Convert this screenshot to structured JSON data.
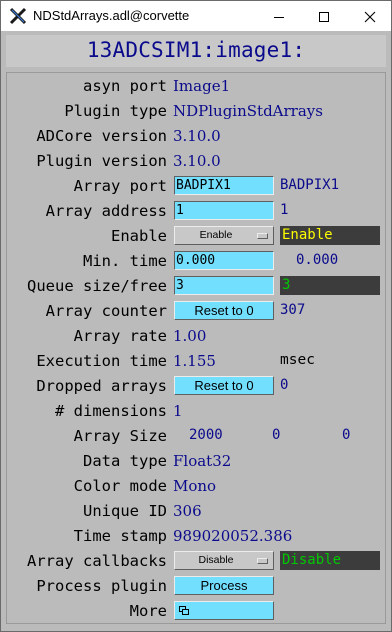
{
  "window": {
    "title": "NDStdArrays.adl@corvette",
    "icon": "x-logo-icon",
    "controls": [
      "minimize-icon",
      "maximize-icon",
      "close-icon"
    ]
  },
  "header": {
    "title": "13ADCSIM1:image1:"
  },
  "colors": {
    "background": "#bbbbbb",
    "monitor_text": "#0a0a8c",
    "control_fill": "#73dfff",
    "status_box": "#3c3c3c",
    "status_yellow": "#fcfc00",
    "status_green": "#00c800"
  },
  "rows": {
    "asyn_port": {
      "label": "asyn port",
      "value": "Image1"
    },
    "plugin_type": {
      "label": "Plugin type",
      "value": "NDPluginStdArrays"
    },
    "adcore_version": {
      "label": "ADCore version",
      "value": "3.10.0"
    },
    "plugin_version": {
      "label": "Plugin version",
      "value": "3.10.0"
    },
    "array_port": {
      "label": "Array port",
      "input": "BADPIX1",
      "readback": "BADPIX1"
    },
    "array_address": {
      "label": "Array address",
      "input": "1",
      "readback": "1"
    },
    "enable": {
      "label": "Enable",
      "menu": "Enable",
      "status": "Enable"
    },
    "min_time": {
      "label": "Min. time",
      "input": "0.000",
      "readback": "0.000"
    },
    "queue": {
      "label": "Queue size/free",
      "input": "3",
      "status": "3"
    },
    "array_counter": {
      "label": "Array counter",
      "button": "Reset to 0",
      "readback": "307"
    },
    "array_rate": {
      "label": "Array rate",
      "value": "1.00"
    },
    "execution_time": {
      "label": "Execution time",
      "value": "1.155",
      "unit": "msec"
    },
    "dropped_arrays": {
      "label": "Dropped arrays",
      "button": "Reset to 0",
      "readback": "0"
    },
    "dimensions": {
      "label": "# dimensions",
      "value": "1"
    },
    "array_size": {
      "label": "Array Size",
      "values": [
        "2000",
        "0",
        "0"
      ]
    },
    "data_type": {
      "label": "Data type",
      "value": "Float32"
    },
    "color_mode": {
      "label": "Color mode",
      "value": "Mono"
    },
    "unique_id": {
      "label": "Unique ID",
      "value": "306"
    },
    "time_stamp": {
      "label": "Time stamp",
      "value": "989020052.386"
    },
    "array_callbacks": {
      "label": "Array callbacks",
      "menu": "Disable",
      "status": "Disable"
    },
    "process_plugin": {
      "label": "Process plugin",
      "button": "Process"
    },
    "more": {
      "label": "More",
      "button_icon": "related-display-icon"
    }
  }
}
